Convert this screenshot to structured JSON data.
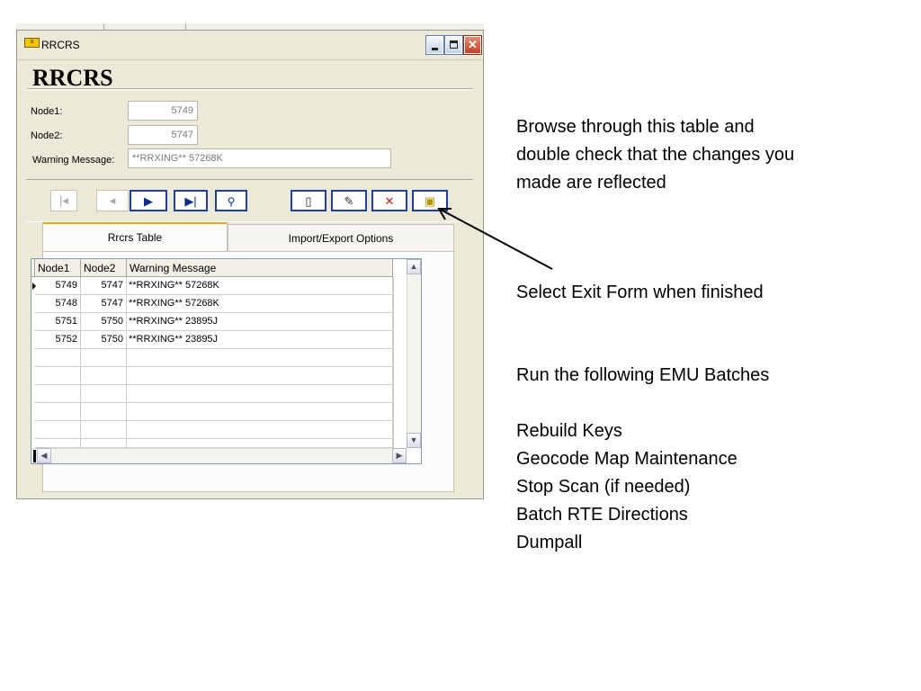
{
  "window": {
    "title": "RRCRS",
    "form_heading": "RRCRS"
  },
  "form": {
    "node1_label": "Node1:",
    "node1_value": "5749",
    "node2_label": "Node2:",
    "node2_value": "5747",
    "warning_label": "Warning Message:",
    "warning_value": "**RRXING** 57268K"
  },
  "navigation": {
    "first": "first-record-icon",
    "prev": "previous-record-icon",
    "next": "next-record-icon",
    "last": "last-record-icon",
    "find": "binoculars-icon",
    "new": "new-record-icon",
    "edit": "edit-record-icon",
    "delete": "delete-record-icon",
    "exit": "exit-form-icon"
  },
  "tabs": [
    {
      "label": "Rrcrs Table",
      "active": true
    },
    {
      "label": "Import/Export Options",
      "active": false
    }
  ],
  "table": {
    "columns": [
      "Node1",
      "Node2",
      "Warning Message"
    ],
    "rows": [
      {
        "node1": "5749",
        "node2": "5747",
        "message": "**RRXING** 57268K"
      },
      {
        "node1": "5748",
        "node2": "5747",
        "message": "**RRXING** 57268K"
      },
      {
        "node1": "5751",
        "node2": "5750",
        "message": "**RRXING** 23895J"
      },
      {
        "node1": "5752",
        "node2": "5750",
        "message": "**RRXING** 23895J"
      }
    ]
  },
  "notes": {
    "browse": [
      "Browse through this table and",
      "double check that the changes you",
      "made are reflected"
    ],
    "exit": "Select Exit Form when finished",
    "run": "Run the following EMU Batches",
    "batches": [
      "Rebuild Keys",
      "Geocode Map Maintenance",
      "Stop Scan (if needed)",
      "Batch RTE Directions",
      "Dumpall"
    ]
  }
}
